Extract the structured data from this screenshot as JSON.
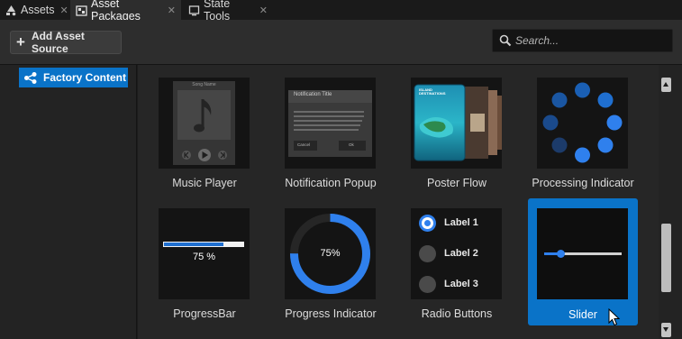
{
  "tabs": [
    {
      "label": "Assets",
      "icon": "assets-icon",
      "active": false
    },
    {
      "label": "Asset Packages",
      "icon": "asset-packages-icon",
      "active": true
    },
    {
      "label": "State Tools",
      "icon": "state-tools-icon",
      "active": false
    }
  ],
  "toolbar": {
    "add_label": "Add Asset Source"
  },
  "search": {
    "placeholder": "Search..."
  },
  "sidebar": {
    "items": [
      {
        "label": "Factory Content",
        "icon": "network-icon",
        "selected": true
      }
    ]
  },
  "assets": [
    {
      "label": "Music Player",
      "thumb": {
        "song_name": "Song Name"
      }
    },
    {
      "label": "Notification Popup",
      "thumb": {
        "title": "Notification Title",
        "cancel": "Cancel",
        "ok": "Ok"
      }
    },
    {
      "label": "Poster Flow",
      "thumb": {
        "headline": "ISLAND DESTINATIONS"
      }
    },
    {
      "label": "Processing Indicator"
    },
    {
      "label": "ProgressBar",
      "thumb": {
        "value_text": "75 %",
        "fraction": 0.75
      }
    },
    {
      "label": "Progress Indicator",
      "thumb": {
        "value_text": "75%",
        "fraction": 0.75
      }
    },
    {
      "label": "Radio Buttons",
      "thumb": {
        "options": [
          "Label 1",
          "Label 2",
          "Label 3"
        ],
        "selected": 0
      }
    },
    {
      "label": "Slider",
      "selected": true,
      "thumb": {
        "value_fraction": 0.22
      }
    }
  ],
  "colors": {
    "accent": "#0a73c8",
    "bright_blue": "#2f80ed",
    "panel": "#262626",
    "thumb_bg": "#141414"
  }
}
